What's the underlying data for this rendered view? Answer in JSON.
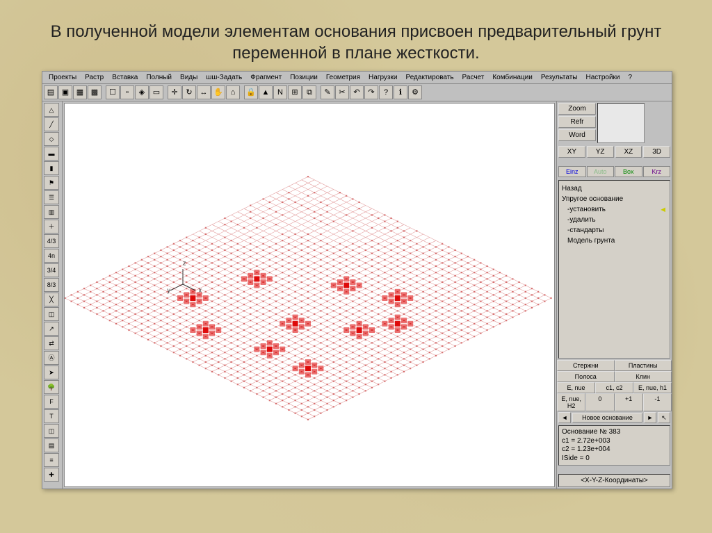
{
  "slide": {
    "title": "В полученной модели элементам основания присвоен предварительный грунт переменной в плане жесткости."
  },
  "menu": {
    "items": [
      "Проекты",
      "Растр",
      "Вставка",
      "Полный",
      "Виды",
      "шш-Задать",
      "Фрагмент",
      "Позиции",
      "Геометрия",
      "Нагрузки",
      "Редактировать",
      "Расчет",
      "Комбинации",
      "Результаты",
      "Настройки",
      "?"
    ]
  },
  "top_toolbar": {
    "icons": [
      "file",
      "save",
      "grid1",
      "grid2",
      "grid3",
      "grid4",
      "view",
      "sel",
      "axis",
      "rot",
      "msr",
      "hand",
      "home",
      "lock",
      "warn",
      "N",
      "mesh",
      "copy",
      "paste",
      "cut",
      "undo",
      "redo",
      "?",
      "help",
      "opts"
    ]
  },
  "left_toolbar": {
    "icons": [
      "tri",
      "line",
      "poly",
      "beam",
      "col",
      "flag",
      "layer",
      "grp",
      "add",
      "4/3",
      "4n",
      "3/4",
      "8/3",
      "diag",
      "elem",
      "vec",
      "pair",
      "label",
      "arr",
      "tree",
      "F",
      "text",
      "chart",
      "lt",
      "bars",
      "ax"
    ]
  },
  "right": {
    "zoom": "Zoom",
    "refr": "Refr",
    "word": "Word",
    "views": [
      "XY",
      "YZ",
      "XZ",
      "3D"
    ],
    "modes": [
      "Einz",
      "Auto",
      "Box",
      "Krz"
    ],
    "tree": {
      "back": "Назад",
      "root": "Упругое основание",
      "items": [
        "-установить",
        "-удалить",
        "-стандарты",
        "Модель грунта"
      ]
    },
    "tabs1": [
      "Стержни",
      "Пластины"
    ],
    "tabs2": [
      "Полоса",
      "Клин"
    ],
    "grid1": [
      "E, nue",
      "c1, c2",
      "E, nue, h1"
    ],
    "grid2": [
      "E, nue, H2",
      "0",
      "+1",
      "-1"
    ],
    "nav": {
      "prev": "◄",
      "label": "Новое основание",
      "next": "►",
      "ptr": "↖"
    },
    "info": {
      "l1": "Основание № 383",
      "l2": "c1   = 2.72e+003",
      "l3": "c2   = 1.23e+004",
      "l4": "ISide = 0"
    },
    "status": "<X-Y-Z-Координаты>"
  },
  "axes": {
    "x": "x",
    "y": "y",
    "z": "z"
  }
}
